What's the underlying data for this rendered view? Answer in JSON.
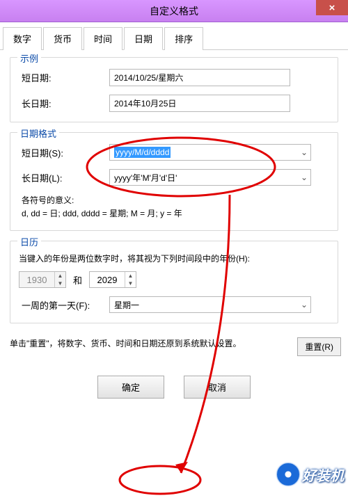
{
  "titlebar": {
    "title": "自定义格式",
    "close_glyph": "×"
  },
  "tabs": {
    "tab0": "数字",
    "tab1": "货币",
    "tab2": "时间",
    "tab3": "日期",
    "tab4": "排序"
  },
  "example": {
    "legend": "示例",
    "short_label": "短日期:",
    "short_value": "2014/10/25/星期六",
    "long_label": "长日期:",
    "long_value": "2014年10月25日"
  },
  "format": {
    "legend": "日期格式",
    "short_label": "短日期(S):",
    "short_value": "yyyy/M/d/dddd",
    "long_label": "长日期(L):",
    "long_value": "yyyy'年'M'月'd'日'",
    "meaning_label": "各符号的意义:",
    "meaning_text": "d, dd = 日;  ddd, dddd = 星期;  M = 月;  y = 年"
  },
  "calendar": {
    "legend": "日历",
    "twodigit_text": "当键入的年份是两位数字时，将其视为下列时间段中的年份(H):",
    "year_from": "1930",
    "year_between": "和",
    "year_to": "2029",
    "firstday_label": "一周的第一天(F):",
    "firstday_value": "星期一"
  },
  "footer": {
    "note": "单击\"重置\"，将数字、货币、时间和日期还原到系统默认设置。",
    "reset": "重置(R)"
  },
  "buttons": {
    "ok": "确定",
    "cancel": "取消"
  },
  "watermark": {
    "text": "好装机"
  },
  "arrows": {
    "down": "⌄",
    "up_small": "▲",
    "down_small": "▼"
  }
}
